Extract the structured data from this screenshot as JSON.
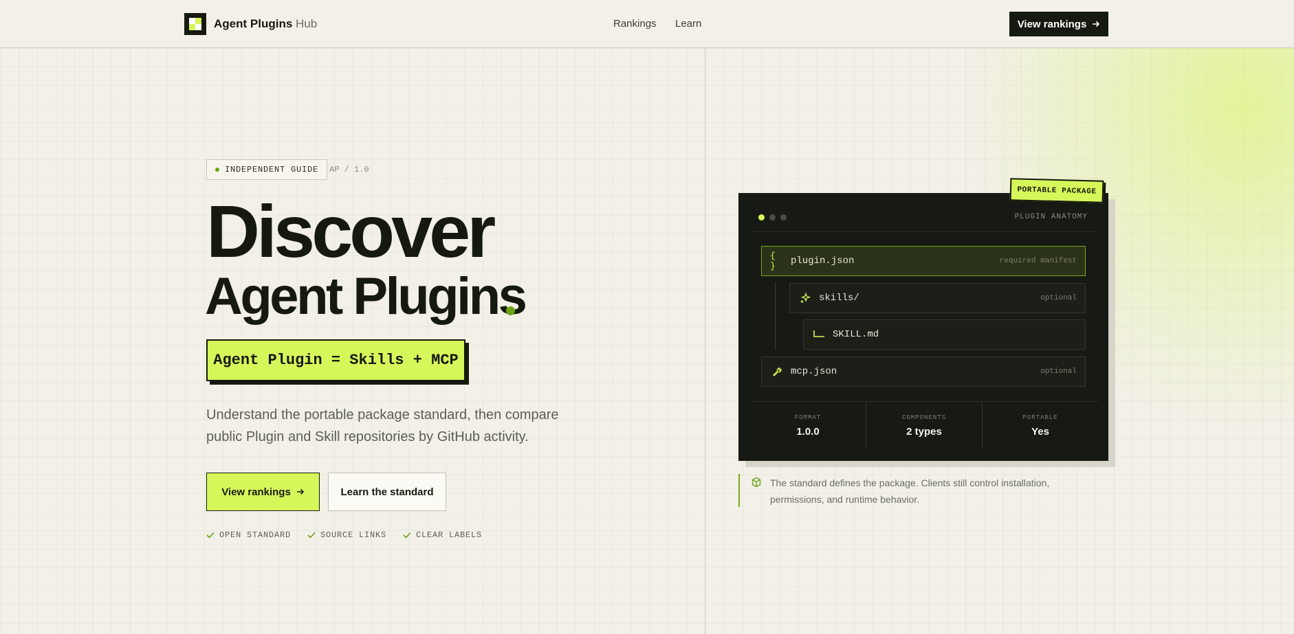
{
  "header": {
    "brand_name": "Agent Plugins",
    "brand_suffix": "Hub",
    "nav": [
      "Rankings",
      "Learn"
    ],
    "cta_label": "View rankings"
  },
  "hero": {
    "badge": "INDEPENDENT GUIDE",
    "version": "AP / 1.0",
    "title_line1": "Discover",
    "title_line2": "Agent Plugins",
    "formula": "Agent Plugin = Skills + MCP",
    "subtitle": "Understand the portable package standard, then compare public Plugin and Skill repositories by GitHub activity.",
    "primary_button": "View rankings",
    "secondary_button": "Learn the standard",
    "checks": [
      "OPEN STANDARD",
      "SOURCE LINKS",
      "CLEAR LABELS"
    ]
  },
  "panel": {
    "tag": "PORTABLE PACKAGE",
    "header_label": "PLUGIN ANATOMY",
    "rows": [
      {
        "icon": "braces-icon",
        "name": "plugin.json",
        "tag": "required manifest"
      },
      {
        "icon": "sparkle-icon",
        "name": "skills/",
        "tag": "optional"
      },
      {
        "icon": "tree-branch-icon",
        "name": "SKILL.md",
        "tag": ""
      },
      {
        "icon": "wrench-icon",
        "name": "mcp.json",
        "tag": "optional"
      }
    ],
    "stats": [
      {
        "label": "FORMAT",
        "value": "1.0.0"
      },
      {
        "label": "COMPONENTS",
        "value": "2 types"
      },
      {
        "label": "PORTABLE",
        "value": "Yes"
      }
    ],
    "note": "The standard defines the package. Clients still control installation, permissions, and runtime behavior."
  },
  "colors": {
    "accent": "#d6f75a",
    "accent_dark": "#6aa313",
    "ink": "#16190f",
    "background": "#f2f0e7",
    "panel": "#171a14"
  }
}
